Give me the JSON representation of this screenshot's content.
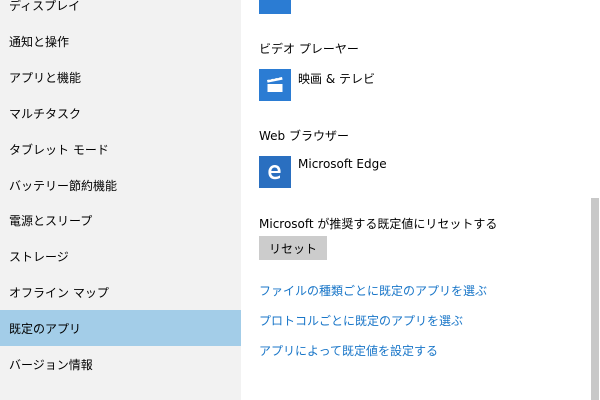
{
  "sidebar": {
    "items": [
      {
        "label": "ディスプレイ"
      },
      {
        "label": "通知と操作"
      },
      {
        "label": "アプリと機能"
      },
      {
        "label": "マルチタスク"
      },
      {
        "label": "タブレット モード"
      },
      {
        "label": "バッテリー節約機能"
      },
      {
        "label": "電源とスリープ"
      },
      {
        "label": "ストレージ"
      },
      {
        "label": "オフライン マップ"
      },
      {
        "label": "既定のアプリ",
        "selected": true
      },
      {
        "label": "バージョン情報"
      }
    ]
  },
  "main": {
    "video_player": {
      "heading": "ビデオ プレーヤー",
      "app_name": "映画 & テレビ",
      "icon": "film-clapper-icon"
    },
    "web_browser": {
      "heading": "Web ブラウザー",
      "app_name": "Microsoft Edge",
      "icon": "edge-e-icon"
    },
    "reset": {
      "description": "Microsoft が推奨する既定値にリセットする",
      "button_label": "リセット"
    },
    "links": [
      {
        "label": "ファイルの種類ごとに既定のアプリを選ぶ"
      },
      {
        "label": "プロトコルごとに既定のアプリを選ぶ"
      },
      {
        "label": "アプリによって既定値を設定する"
      }
    ]
  },
  "colors": {
    "accent": "#2b7cd3",
    "link": "#1976c8",
    "sidebar_bg": "#f2f2f2",
    "selected_bg": "#a3cde8",
    "button_bg": "#cccccc",
    "scrollbar_thumb": "#c8c8c8"
  }
}
